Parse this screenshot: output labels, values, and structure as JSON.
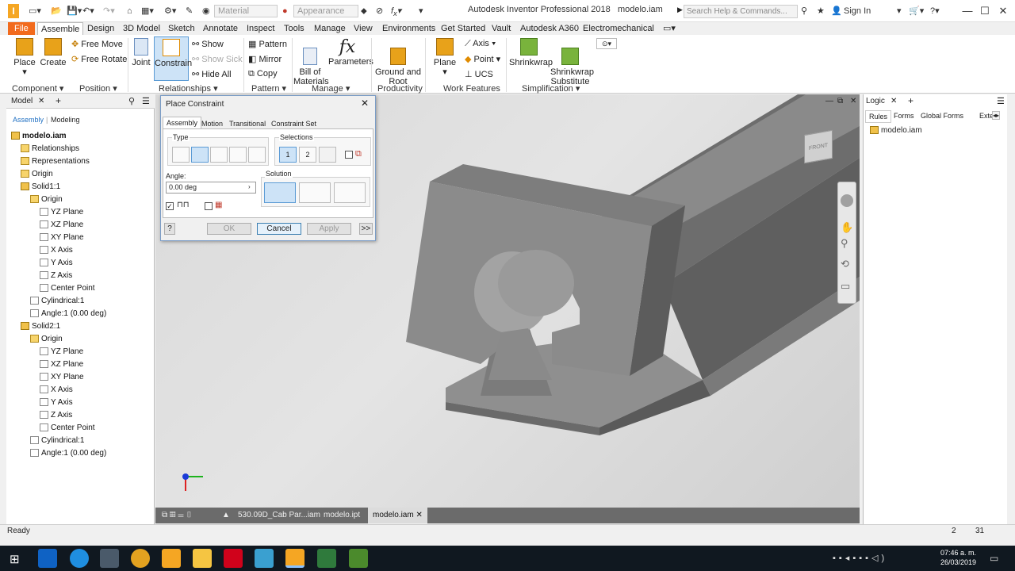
{
  "window": {
    "title": "Autodesk Inventor Professional 2018",
    "file": "modelo.iam",
    "search_placeholder": "Search Help & Commands...",
    "sign_in": "Sign In"
  },
  "quick_access": {
    "material": "Material",
    "appearance": "Appearance"
  },
  "tabs": [
    "File",
    "Assemble",
    "Design",
    "3D Model",
    "Sketch",
    "Annotate",
    "Inspect",
    "Tools",
    "Manage",
    "View",
    "Environments",
    "Get Started",
    "Vault",
    "Autodesk A360",
    "Electromechanical"
  ],
  "ribbon": {
    "place": "Place",
    "create": "Create",
    "free_move": "Free Move",
    "free_rotate": "Free Rotate",
    "joint": "Joint",
    "constrain": "Constrain",
    "show": "Show",
    "show_sick": "Show Sick",
    "hide_all": "Hide All",
    "pattern": "Pattern",
    "mirror": "Mirror",
    "copy": "Copy",
    "bill_of_materials": "Bill of\nMaterials",
    "parameters": "Parameters",
    "ground_and_root": "Ground and\nRoot",
    "plane": "Plane",
    "axis": "Axis",
    "point": "Point",
    "ucs": "UCS",
    "shrinkwrap": "Shrinkwrap",
    "shrinkwrap_substitute": "Shrinkwrap\nSubstitute",
    "panels": [
      "Component",
      "Position",
      "Relationships",
      "Pattern",
      "Manage",
      "Productivity",
      "Work Features",
      "Simplification"
    ]
  },
  "browser": {
    "tab": "Model",
    "subtabs": [
      "Assembly",
      "Modeling"
    ],
    "items": [
      {
        "label": "modelo.iam",
        "level": 0,
        "icon": "assembly"
      },
      {
        "label": "Relationships",
        "level": 1,
        "icon": "folder"
      },
      {
        "label": "Representations",
        "level": 1,
        "icon": "folder"
      },
      {
        "label": "Origin",
        "level": 1,
        "icon": "folder"
      },
      {
        "label": "Solid1:1",
        "level": 1,
        "icon": "solid"
      },
      {
        "label": "Origin",
        "level": 2,
        "icon": "folder"
      },
      {
        "label": "YZ Plane",
        "level": 3,
        "icon": "plane"
      },
      {
        "label": "XZ Plane",
        "level": 3,
        "icon": "plane"
      },
      {
        "label": "XY Plane",
        "level": 3,
        "icon": "plane"
      },
      {
        "label": "X Axis",
        "level": 3,
        "icon": "plane"
      },
      {
        "label": "Y Axis",
        "level": 3,
        "icon": "plane"
      },
      {
        "label": "Z Axis",
        "level": 3,
        "icon": "plane"
      },
      {
        "label": "Center Point",
        "level": 3,
        "icon": "point"
      },
      {
        "label": "Cylindrical:1",
        "level": 2,
        "icon": "constraint"
      },
      {
        "label": "Angle:1 (0.00 deg)",
        "level": 2,
        "icon": "constraint"
      },
      {
        "label": "Solid2:1",
        "level": 1,
        "icon": "solid"
      },
      {
        "label": "Origin",
        "level": 2,
        "icon": "folder"
      },
      {
        "label": "YZ Plane",
        "level": 3,
        "icon": "plane"
      },
      {
        "label": "XZ Plane",
        "level": 3,
        "icon": "plane"
      },
      {
        "label": "XY Plane",
        "level": 3,
        "icon": "plane"
      },
      {
        "label": "X Axis",
        "level": 3,
        "icon": "plane"
      },
      {
        "label": "Y Axis",
        "level": 3,
        "icon": "plane"
      },
      {
        "label": "Z Axis",
        "level": 3,
        "icon": "plane"
      },
      {
        "label": "Center Point",
        "level": 3,
        "icon": "point"
      },
      {
        "label": "Cylindrical:1",
        "level": 2,
        "icon": "constraint"
      },
      {
        "label": "Angle:1 (0.00 deg)",
        "level": 2,
        "icon": "constraint"
      }
    ]
  },
  "dialog": {
    "title": "Place Constraint",
    "tabs": [
      "Assembly",
      "Motion",
      "Transitional",
      "Constraint Set"
    ],
    "type_label": "Type",
    "selections_label": "Selections",
    "angle_label": "Angle:",
    "angle_value": "0.00 deg",
    "solution_label": "Solution",
    "ok": "OK",
    "cancel": "Cancel",
    "apply": "Apply",
    "more": ">>",
    "help": "?",
    "sel1": "1",
    "sel2": "2"
  },
  "logic": {
    "tab": "Logic",
    "subtabs": [
      "Rules",
      "Forms",
      "Global Forms",
      "Extern"
    ],
    "item": "modelo.iam"
  },
  "viewcube": {
    "face": "FRONT"
  },
  "doc_tabs": [
    "530.09D_Cab Par...iam",
    "modelo.ipt",
    "modelo.iam"
  ],
  "status": {
    "text": "Ready",
    "num1": "2",
    "num2": "31"
  },
  "taskbar": {
    "time": "07:46 a. m.",
    "date": "26/03/2019"
  }
}
